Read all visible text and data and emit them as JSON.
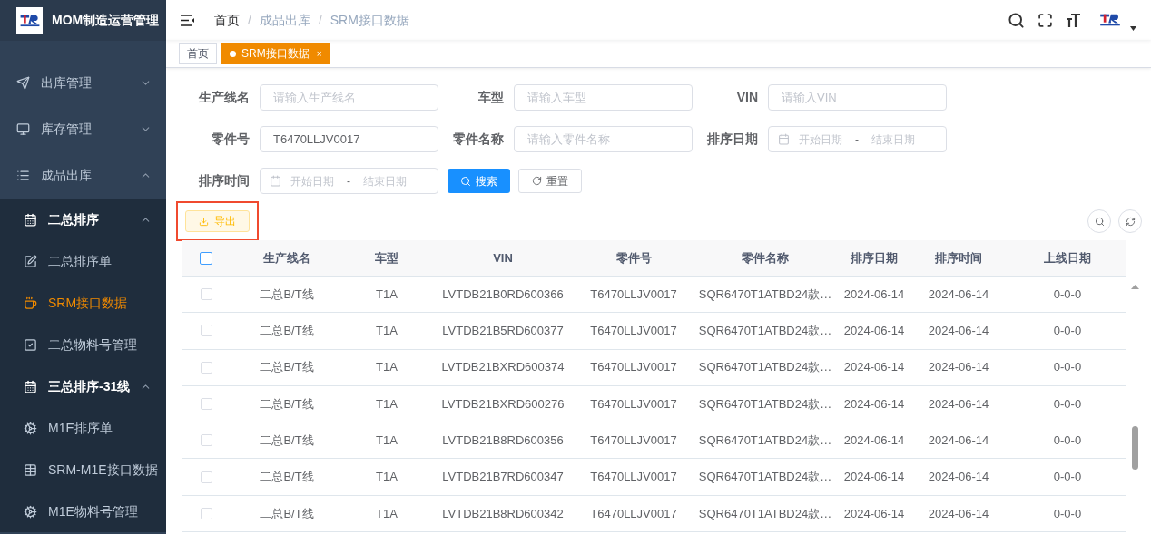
{
  "app": {
    "title": "MOM制造运营管理"
  },
  "menu": [
    {
      "label": "出库管理",
      "expanded": false,
      "selected": false
    },
    {
      "label": "库存管理",
      "expanded": false,
      "selected": false
    },
    {
      "label": "成品出库",
      "expanded": true,
      "selected": false,
      "children": [
        {
          "label": "二总排序",
          "expanded": true,
          "selected": false,
          "children": [
            {
              "label": "二总排序单",
              "selected": false
            },
            {
              "label": "SRM接口数据",
              "selected": true
            },
            {
              "label": "二总物料号管理",
              "selected": false
            }
          ]
        },
        {
          "label": "三总排序-31线",
          "expanded": true,
          "selected": false,
          "children": [
            {
              "label": "M1E排序单",
              "selected": false
            },
            {
              "label": "SRM-M1E接口数据",
              "selected": false
            },
            {
              "label": "M1E物料号管理",
              "selected": false
            }
          ]
        }
      ]
    }
  ],
  "breadcrumb": {
    "separator": "/",
    "items": [
      "首页",
      "成品出库",
      "SRM接口数据"
    ]
  },
  "tabs": [
    {
      "label": "首页",
      "selected": false
    },
    {
      "label": "SRM接口数据",
      "selected": true,
      "close": "×"
    }
  ],
  "filters": [
    {
      "label": "生产线名",
      "kind": "text",
      "placeholder": "请输入生产线名"
    },
    {
      "label": "车型",
      "kind": "text",
      "placeholder": "请输入车型"
    },
    {
      "label": "VIN",
      "kind": "text",
      "placeholder": "请输入VIN"
    },
    {
      "label": "零件号",
      "kind": "text",
      "value": "T6470LLJV0017"
    },
    {
      "label": "零件名称",
      "kind": "text",
      "placeholder": "请输入零件名称"
    },
    {
      "label": "排序日期",
      "kind": "daterange",
      "start_placeholder": "开始日期",
      "separator": "-",
      "end_placeholder": "结束日期"
    },
    {
      "label": "排序时间",
      "kind": "daterange",
      "start_placeholder": "开始日期",
      "separator": "-",
      "end_placeholder": "结束日期"
    }
  ],
  "search_button": "搜索",
  "reset_button": "重置",
  "export_button": {
    "label": "导出",
    "highlighted": true
  },
  "table": {
    "header_checked": false,
    "columns": [
      "生产线名",
      "车型",
      "VIN",
      "零件号",
      "零件名称",
      "排序日期",
      "排序时间",
      "上线日期"
    ],
    "rows": [
      {
        "checked": false,
        "cells": [
          "二总B/T线",
          "T1A",
          "LVTDB21B0RD600366",
          "T6470LLJV0017",
          "SQR6470T1ATBD24款…",
          "2024-06-14",
          "2024-06-14",
          "0-0-0"
        ]
      },
      {
        "checked": false,
        "cells": [
          "二总B/T线",
          "T1A",
          "LVTDB21B5RD600377",
          "T6470LLJV0017",
          "SQR6470T1ATBD24款…",
          "2024-06-14",
          "2024-06-14",
          "0-0-0"
        ]
      },
      {
        "checked": false,
        "cells": [
          "二总B/T线",
          "T1A",
          "LVTDB21BXRD600374",
          "T6470LLJV0017",
          "SQR6470T1ATBD24款…",
          "2024-06-14",
          "2024-06-14",
          "0-0-0"
        ]
      },
      {
        "checked": false,
        "cells": [
          "二总B/T线",
          "T1A",
          "LVTDB21BXRD600276",
          "T6470LLJV0017",
          "SQR6470T1ATBD24款…",
          "2024-06-14",
          "2024-06-14",
          "0-0-0"
        ]
      },
      {
        "checked": false,
        "cells": [
          "二总B/T线",
          "T1A",
          "LVTDB21B8RD600356",
          "T6470LLJV0017",
          "SQR6470T1ATBD24款…",
          "2024-06-14",
          "2024-06-14",
          "0-0-0"
        ]
      },
      {
        "checked": false,
        "cells": [
          "二总B/T线",
          "T1A",
          "LVTDB21B7RD600347",
          "T6470LLJV0017",
          "SQR6470T1ATBD24款…",
          "2024-06-14",
          "2024-06-14",
          "0-0-0"
        ]
      },
      {
        "checked": false,
        "cells": [
          "二总B/T线",
          "T1A",
          "LVTDB21B8RD600342",
          "T6470LLJV0017",
          "SQR6470T1ATBD24款…",
          "2024-06-14",
          "2024-06-14",
          "0-0-0"
        ]
      }
    ]
  }
}
